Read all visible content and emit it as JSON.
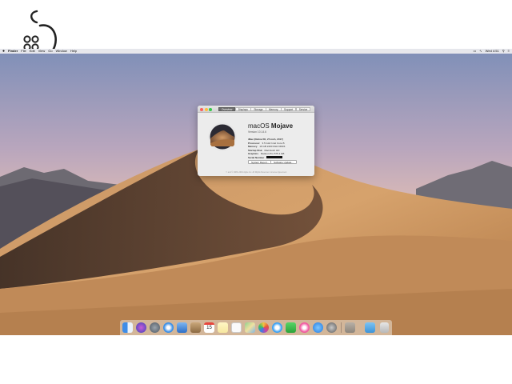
{
  "menubar": {
    "apple_icon": "apple-icon",
    "app": "Finder",
    "items": [
      "File",
      "Edit",
      "View",
      "Go",
      "Window",
      "Help"
    ],
    "clock": "Wed 4:51"
  },
  "about_window": {
    "tabs": [
      "Overview",
      "Displays",
      "Storage",
      "Memory",
      "Support",
      "Service"
    ],
    "os_name_light": "macOS",
    "os_name_bold": "Mojave",
    "version": "Version 10.14.6",
    "specs": [
      {
        "key": "iMac (Retina 5K, 27-inch, 2017)",
        "val": ""
      },
      {
        "key": "Processor",
        "val": "3.5 GHz Intel Core i5"
      },
      {
        "key": "Memory",
        "val": "16 GB 2400 MHz DDR4"
      },
      {
        "key": "Startup Disk",
        "val": "Macintosh HD"
      },
      {
        "key": "Graphics",
        "val": "Radeon Pro 575 4 GB"
      },
      {
        "key": "Serial Number",
        "val": ""
      }
    ],
    "buttons": [
      "System Report...",
      "Software Update..."
    ],
    "copyright": "™ and © 1983–2019 Apple Inc. All Rights Reserved. License Agreement"
  },
  "dock": {
    "icons": [
      "finder-icon",
      "siri-icon",
      "launchpad-icon",
      "safari-icon",
      "mail-icon",
      "contacts-icon",
      "calendar-icon",
      "notes-icon",
      "reminders-icon",
      "maps-icon",
      "photos-icon",
      "messages-icon",
      "facetime-icon",
      "itunes-icon",
      "app-store-icon",
      "system-preferences-icon",
      "downloads-icon",
      "folder-icon",
      "trash-icon"
    ],
    "calendar_day": "15"
  }
}
